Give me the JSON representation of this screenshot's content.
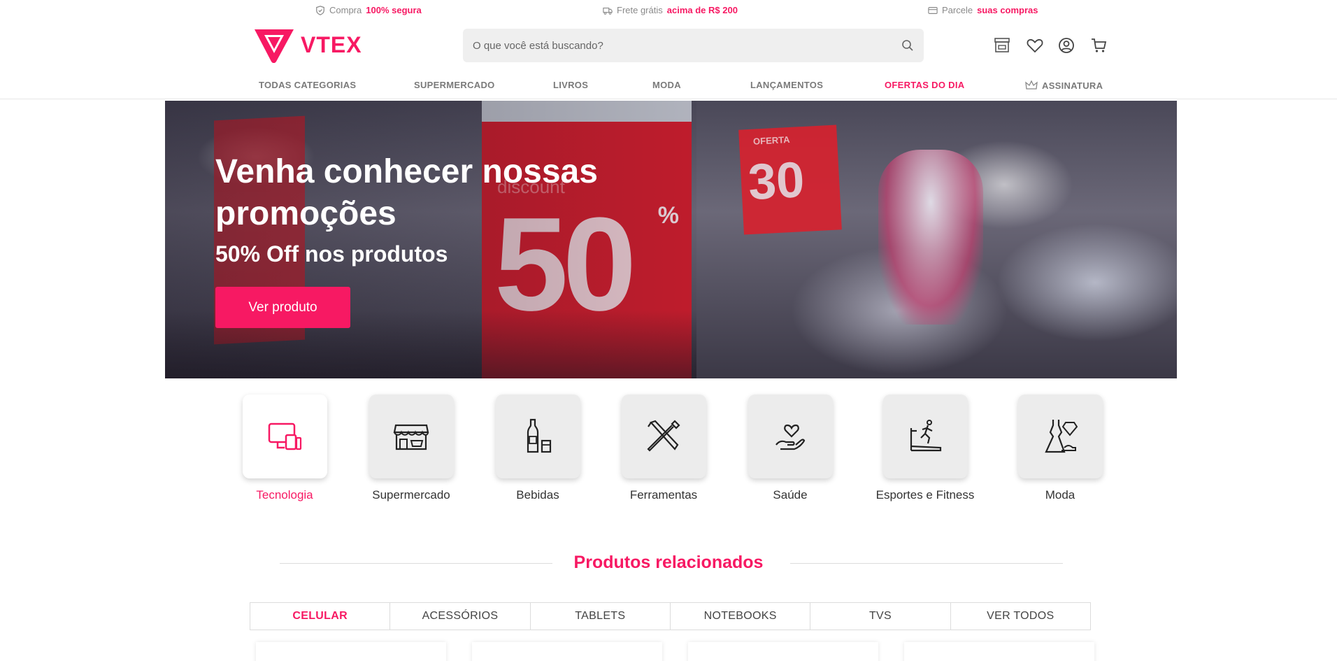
{
  "topbar": {
    "secure": {
      "prefix": "Compra",
      "highlight": "100% segura",
      "icon": "shield-icon"
    },
    "shipping": {
      "prefix": "Frete grátis",
      "highlight": "acima de R$ 200",
      "icon": "truck-icon"
    },
    "installments": {
      "prefix": "Parcele",
      "highlight": "suas compras",
      "icon": "credit-card-icon"
    }
  },
  "header": {
    "brand": "VTEX",
    "search_placeholder": "O que você está buscando?",
    "icons": [
      "store-icon",
      "heart-icon",
      "user-icon",
      "cart-icon"
    ]
  },
  "nav": {
    "items": [
      "TODAS CATEGORIAS",
      "SUPERMERCADO",
      "LIVROS",
      "MODA",
      "LANÇAMENTOS",
      "OFERTAS DO DIA",
      "ASSINATURA"
    ],
    "highlight_color": "#f71963"
  },
  "hero": {
    "title": "Venha conhecer nossas promoções",
    "subtitle": "50% Off nos produtos",
    "cta": "Ver produto"
  },
  "categories": [
    {
      "label": "Tecnologia",
      "icon": "devices-icon",
      "active": true
    },
    {
      "label": "Supermercado",
      "icon": "market-icon",
      "active": false
    },
    {
      "label": "Bebidas",
      "icon": "bottle-icon",
      "active": false
    },
    {
      "label": "Ferramentas",
      "icon": "tools-icon",
      "active": false
    },
    {
      "label": "Saúde",
      "icon": "heart-hand-icon",
      "active": false
    },
    {
      "label": "Esportes e Fitness",
      "icon": "treadmill-icon",
      "active": false
    },
    {
      "label": "Moda",
      "icon": "dress-icon",
      "active": false
    }
  ],
  "related": {
    "title": "Produtos relacionados",
    "tabs": [
      "CELULAR",
      "ACESSÓRIOS",
      "TABLETS",
      "NOTEBOOKS",
      "TVS",
      "VER TODOS"
    ],
    "active_tab": "CELULAR"
  },
  "colors": {
    "accent": "#f71963"
  }
}
